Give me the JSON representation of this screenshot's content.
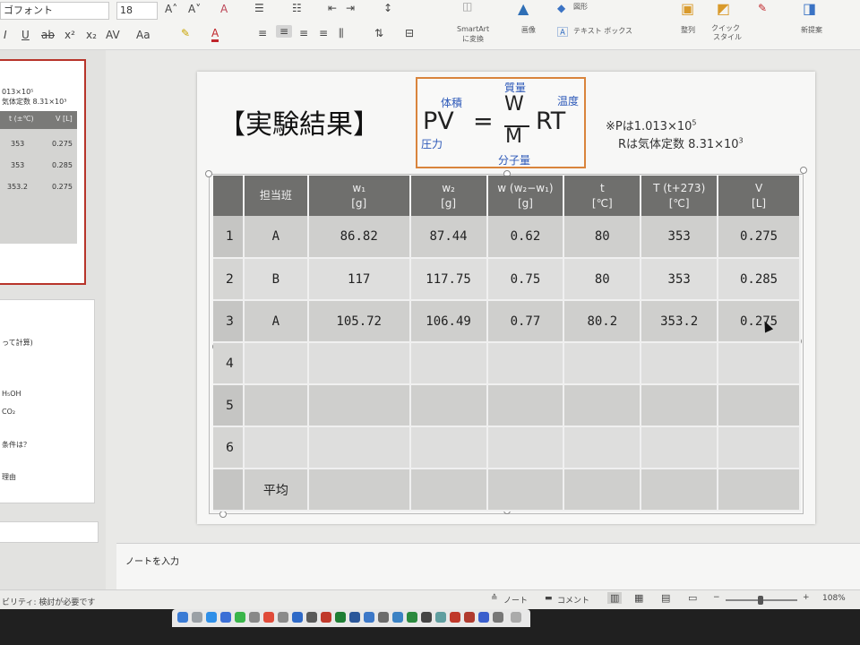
{
  "ribbon": {
    "font_name": "ゴフォント",
    "font_size": "18",
    "grow_font": "A˄",
    "shrink_font": "A˅",
    "clear_format": "A",
    "italic": "I",
    "underline": "U",
    "strike": "ab",
    "superscript": "x²",
    "subscript": "x₂",
    "char_spacing": "AV",
    "change_case": "Aa",
    "highlight": "✎",
    "font_color": "A",
    "smartart_label": "SmartArt",
    "smartart_sub": "に変換",
    "picture_label": "画像",
    "shapes_label": "図形",
    "textbox_label": "テキスト ボックス",
    "arrange_label": "整列",
    "quick_style_label": "クイック",
    "quick_style_sub": "スタイル",
    "designer_label": "新提案"
  },
  "thumbnail": {
    "line1": "013×10⁵",
    "line2": "気体定数 8.31×10³",
    "header_a": "t (±℃)",
    "header_b": "V [L]",
    "r1a": "353",
    "r1b": "0.275",
    "r2a": "353",
    "r2b": "0.285",
    "r3a": "353.2",
    "r3b": "0.275",
    "t2_l1": "って計算)",
    "t2_l2": "H₅OH",
    "t2_l3": "CO₂",
    "t2_l4": "条件は？",
    "t2_l5": "理由"
  },
  "slide": {
    "title": "【実験結果】",
    "formula": {
      "pv": "PV",
      "eq": "=",
      "w": "W",
      "m": "M",
      "rt": "RT",
      "lbl_volume": "体積",
      "lbl_pressure": "圧力",
      "lbl_mass": "質量",
      "lbl_temp": "温度",
      "lbl_molar": "分子量"
    },
    "note_line1": "※Pは1.013×10",
    "note_line1_sup": "5",
    "note_line2": "Rは気体定数 8.31×10",
    "note_line2_sup": "3"
  },
  "table": {
    "headers": [
      {
        "l1": "",
        "l2": ""
      },
      {
        "l1": "担当班",
        "l2": ""
      },
      {
        "l1": "w₁",
        "l2": "[g]"
      },
      {
        "l1": "w₂",
        "l2": "[g]"
      },
      {
        "l1": "w (w₂−w₁)",
        "l2": "[g]"
      },
      {
        "l1": "t",
        "l2": "[℃]"
      },
      {
        "l1": "T (t+273)",
        "l2": "[℃]"
      },
      {
        "l1": "V",
        "l2": "[L]"
      }
    ],
    "rows": [
      [
        "1",
        "A",
        "86.82",
        "87.44",
        "0.62",
        "80",
        "353",
        "0.275"
      ],
      [
        "2",
        "B",
        "117",
        "117.75",
        "0.75",
        "80",
        "353",
        "0.285"
      ],
      [
        "3",
        "A",
        "105.72",
        "106.49",
        "0.77",
        "80.2",
        "353.2",
        "0.275"
      ],
      [
        "4",
        "",
        "",
        "",
        "",
        "",
        "",
        ""
      ],
      [
        "5",
        "",
        "",
        "",
        "",
        "",
        "",
        ""
      ],
      [
        "6",
        "",
        "",
        "",
        "",
        "",
        "",
        ""
      ],
      [
        "",
        "平均",
        "",
        "",
        "",
        "",
        "",
        ""
      ]
    ]
  },
  "notes": {
    "placeholder": "ノートを入力"
  },
  "status": {
    "accessibility": "ビリティ: 検討が必要です",
    "notes_btn": "ノート",
    "comments_btn": "コメント",
    "zoom": "108%"
  }
}
